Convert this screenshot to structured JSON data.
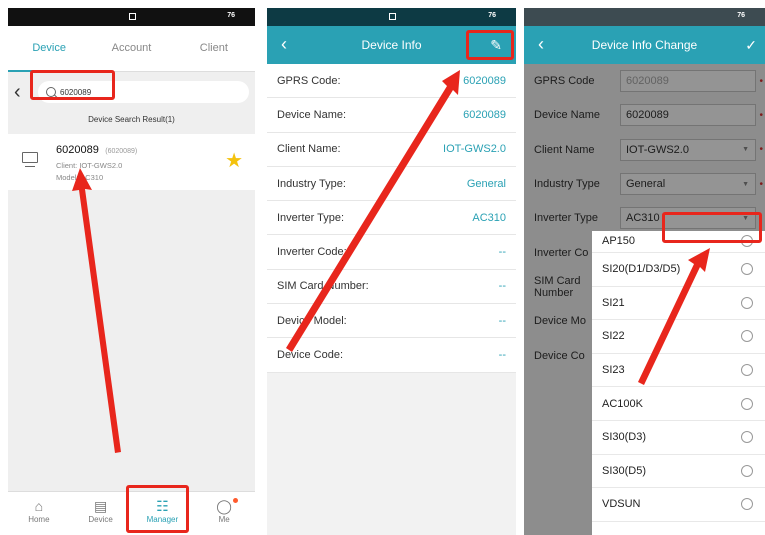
{
  "status": {
    "battery": "76"
  },
  "screen1": {
    "tabs": [
      "Device",
      "Account",
      "Client"
    ],
    "search": {
      "value": "6020089"
    },
    "result_count": "Device Search Result(1)",
    "device": {
      "code": "6020089",
      "code_sub": "(6020089)",
      "client": "Client:  IOT-GWS2.0",
      "model": "Model:  AC310"
    },
    "bottom_nav": [
      "Home",
      "Device",
      "Manager",
      "Me"
    ]
  },
  "screen2": {
    "title": "Device Info",
    "rows": [
      {
        "label": "GPRS Code:",
        "value": "6020089"
      },
      {
        "label": "Device Name:",
        "value": "6020089"
      },
      {
        "label": "Client Name:",
        "value": "IOT-GWS2.0"
      },
      {
        "label": "Industry Type:",
        "value": "General"
      },
      {
        "label": "Inverter Type:",
        "value": "AC310"
      },
      {
        "label": "Inverter Code:",
        "value": "--"
      },
      {
        "label": "SIM Card Number:",
        "value": "--"
      },
      {
        "label": "Device Model:",
        "value": "--"
      },
      {
        "label": "Device Code:",
        "value": "--"
      }
    ]
  },
  "screen3": {
    "title": "Device Info Change",
    "rows": [
      {
        "label": "GPRS Code",
        "value": "6020089"
      },
      {
        "label": "Device Name",
        "value": "6020089"
      },
      {
        "label": "Client Name",
        "value": "IOT-GWS2.0"
      },
      {
        "label": "Industry Type",
        "value": "General"
      },
      {
        "label": "Inverter Type",
        "value": "AC310"
      },
      {
        "label": "Inverter Co"
      },
      {
        "label": "SIM Card Number"
      },
      {
        "label": "Device Mo"
      },
      {
        "label": "Device Co"
      }
    ],
    "options": [
      "AP150",
      "SI20(D1/D3/D5)",
      "SI21",
      "SI22",
      "SI23",
      "AC100K",
      "SI30(D3)",
      "SI30(D5)",
      "VDSUN"
    ]
  },
  "colors": {
    "accent": "#2aa1b4",
    "annotation": "#e8261c",
    "star": "#f4c20d"
  }
}
